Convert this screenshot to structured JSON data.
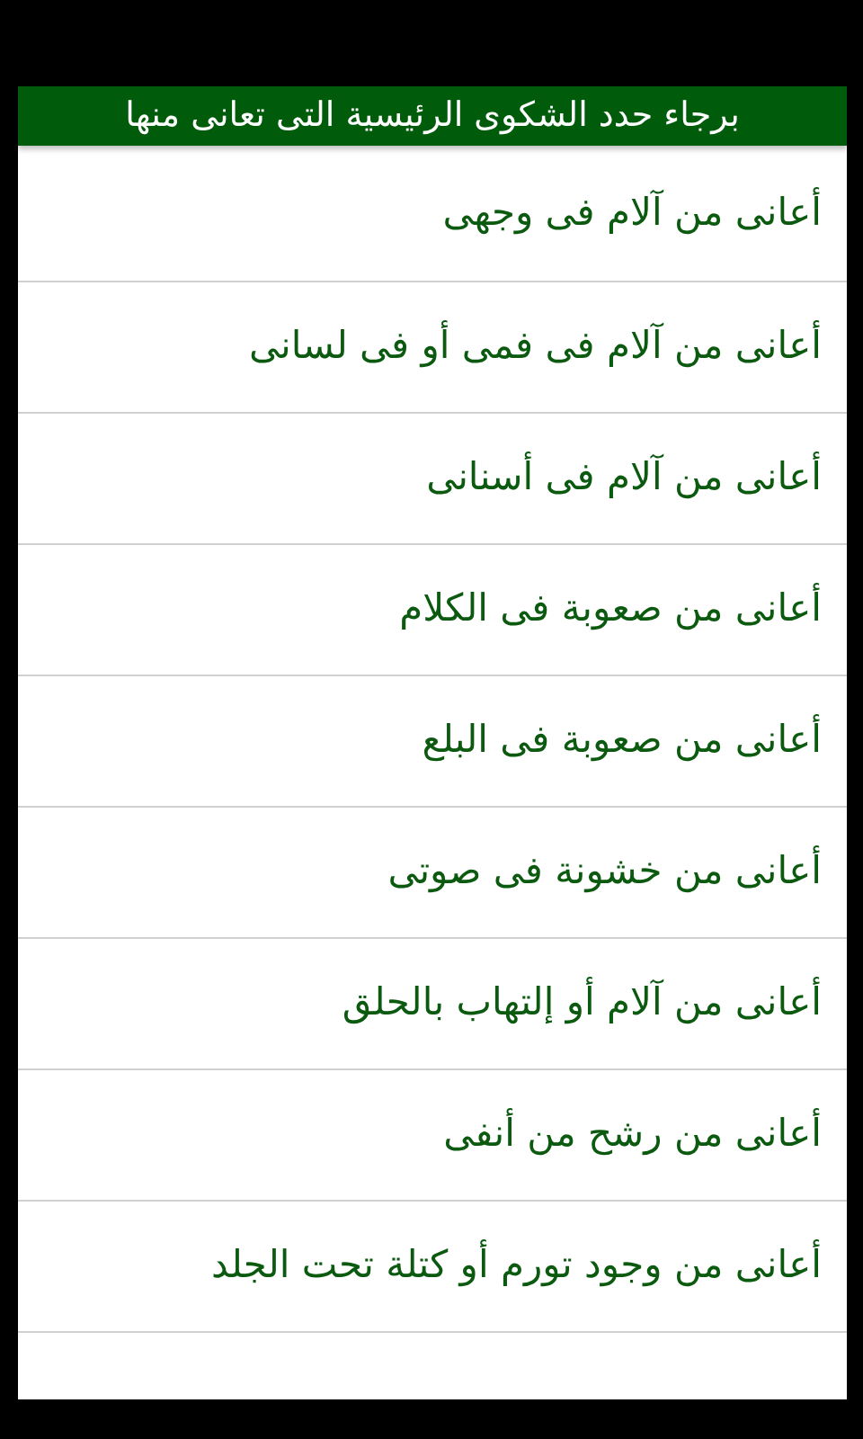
{
  "header": {
    "title": "برجاء حدد الشكوى الرئيسية التى تعانى منها"
  },
  "items": [
    {
      "label": "أعانى من آلام فى وجهى"
    },
    {
      "label": "أعانى من آلام فى فمى أو فى لسانى"
    },
    {
      "label": "أعانى من آلام فى أسنانى"
    },
    {
      "label": "أعانى من صعوبة فى الكلام"
    },
    {
      "label": "أعانى من صعوبة فى البلع"
    },
    {
      "label": "أعانى من خشونة فى صوتى"
    },
    {
      "label": "أعانى من آلام أو إلتهاب بالحلق"
    },
    {
      "label": "أعانى من رشح من أنفى"
    },
    {
      "label": "أعانى من وجود تورم أو كتلة تحت الجلد"
    }
  ]
}
